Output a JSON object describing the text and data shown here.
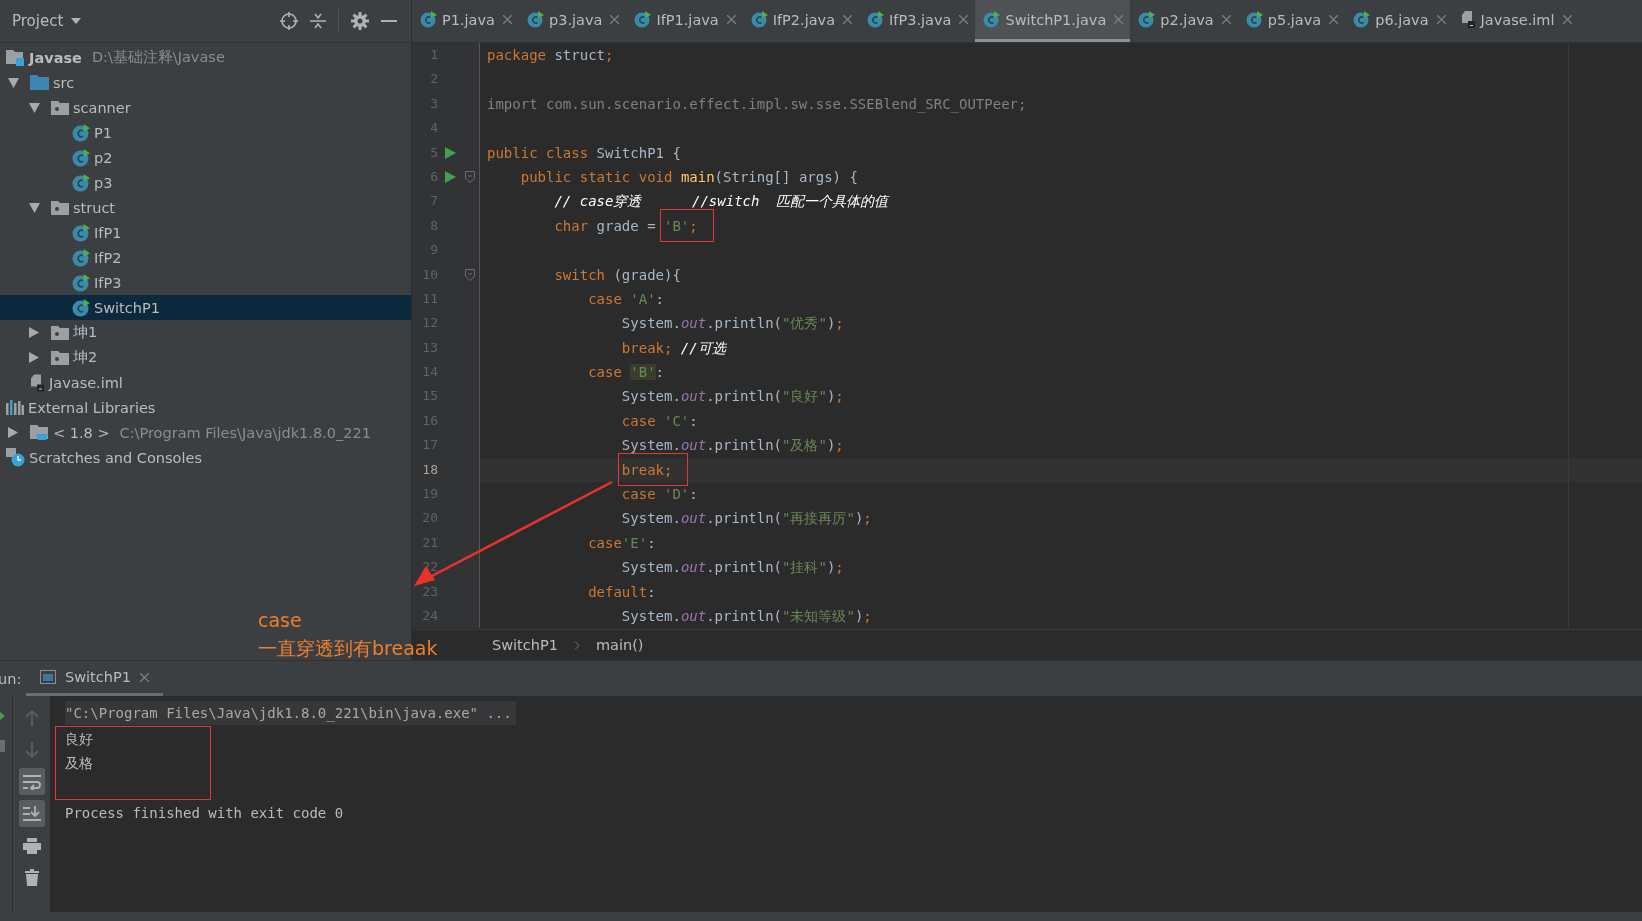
{
  "project_panel": {
    "title": "Project"
  },
  "tabs": [
    {
      "label": "P1.java",
      "kind": "class",
      "selected": false
    },
    {
      "label": "p3.java",
      "kind": "class",
      "selected": false
    },
    {
      "label": "IfP1.java",
      "kind": "class",
      "selected": false
    },
    {
      "label": "IfP2.java",
      "kind": "class",
      "selected": false
    },
    {
      "label": "IfP3.java",
      "kind": "class",
      "selected": false
    },
    {
      "label": "SwitchP1.java",
      "kind": "class",
      "selected": true
    },
    {
      "label": "p2.java",
      "kind": "class",
      "selected": false
    },
    {
      "label": "p5.java",
      "kind": "class",
      "selected": false
    },
    {
      "label": "p6.java",
      "kind": "class",
      "selected": false
    },
    {
      "label": "Javase.iml",
      "kind": "file",
      "selected": false
    }
  ],
  "tree": [
    {
      "label": "Javase",
      "hint": "D:\\基础注释\\Javase",
      "kind": "module",
      "bold": true,
      "selected": false
    },
    {
      "label": "src",
      "kind": "source",
      "expanded": true,
      "selected": false,
      "children": [
        {
          "label": "scanner",
          "kind": "package",
          "expanded": true,
          "selected": false,
          "children": [
            {
              "label": "P1",
              "kind": "class",
              "selected": false
            },
            {
              "label": "p2",
              "kind": "class",
              "selected": false
            },
            {
              "label": "p3",
              "kind": "class",
              "selected": false
            }
          ]
        },
        {
          "label": "struct",
          "kind": "package",
          "expanded": true,
          "selected": false,
          "children": [
            {
              "label": "IfP1",
              "kind": "class",
              "selected": false
            },
            {
              "label": "IfP2",
              "kind": "class",
              "selected": false
            },
            {
              "label": "IfP3",
              "kind": "class",
              "selected": false
            },
            {
              "label": "SwitchP1",
              "kind": "class",
              "selected": true
            }
          ]
        },
        {
          "label": "坤1",
          "kind": "package",
          "expanded": false,
          "selected": false
        },
        {
          "label": "坤2",
          "kind": "package",
          "expanded": false,
          "selected": false
        }
      ]
    },
    {
      "label": "Javase.iml",
      "kind": "file",
      "selected": false
    },
    {
      "label": "External Libraries",
      "kind": "libraries",
      "selected": false
    },
    {
      "label": "< 1.8 >",
      "hint": "C:\\Program Files\\Java\\jdk1.8.0_221",
      "kind": "jdk",
      "expanded": false,
      "selected": false
    },
    {
      "label": "Scratches and Consoles",
      "kind": "scratches",
      "selected": false
    }
  ],
  "code": [
    {
      "number": "1",
      "current": false,
      "tokens": [
        {
          "text": "package",
          "kind": "keyword"
        },
        {
          "text": " struct",
          "kind": "plain"
        },
        {
          "text": ";",
          "kind": "keyword"
        }
      ]
    },
    {
      "number": "2",
      "current": false
    },
    {
      "number": "3",
      "current": false,
      "tokens": [
        {
          "text": "import com.sun.scenario.effect.impl.sw.sse.SSEBlend_SRC_OUTPeer;",
          "kind": "unused"
        }
      ]
    },
    {
      "number": "4",
      "current": false
    },
    {
      "number": "5",
      "current": false,
      "run": true,
      "tokens": [
        {
          "text": "public class ",
          "kind": "keyword"
        },
        {
          "text": "SwitchP1 {",
          "kind": "plain"
        }
      ]
    },
    {
      "number": "6",
      "current": false,
      "run": true,
      "fold": true,
      "tokens": [
        {
          "text": "    public static void ",
          "kind": "keyword"
        },
        {
          "text": "main",
          "kind": "method"
        },
        {
          "text": "(String[] args) {",
          "kind": "plain"
        }
      ]
    },
    {
      "number": "7",
      "current": false,
      "tokens": [
        {
          "text": "        // case穿透      //switch  匹配一个具体的值",
          "kind": "comment"
        }
      ]
    },
    {
      "number": "8",
      "current": false,
      "tokens": [
        {
          "text": "        char",
          "kind": "keyword"
        },
        {
          "text": " grade = ",
          "kind": "plain"
        },
        {
          "text": "'B'",
          "kind": "string",
          "boxed": true
        },
        {
          "text": ";",
          "kind": "keyword",
          "boxed": true
        }
      ]
    },
    {
      "number": "9",
      "current": false
    },
    {
      "number": "10",
      "current": false,
      "fold": true,
      "tokens": [
        {
          "text": "        switch",
          "kind": "keyword"
        },
        {
          "text": " (grade){",
          "kind": "plain"
        }
      ]
    },
    {
      "number": "11",
      "current": false,
      "tokens": [
        {
          "text": "            case ",
          "kind": "keyword"
        },
        {
          "text": "'A'",
          "kind": "string"
        },
        {
          "text": ":",
          "kind": "plain"
        }
      ]
    },
    {
      "number": "12",
      "current": false,
      "tokens": [
        {
          "text": "                System.",
          "kind": "plain"
        },
        {
          "text": "out",
          "kind": "field"
        },
        {
          "text": ".println(",
          "kind": "plain"
        },
        {
          "text": "\"优秀\"",
          "kind": "string"
        },
        {
          "text": ")",
          "kind": "plain"
        },
        {
          "text": ";",
          "kind": "keyword"
        }
      ]
    },
    {
      "number": "13",
      "current": false,
      "tokens": [
        {
          "text": "                break;",
          "kind": "keyword"
        },
        {
          "text": " //可选",
          "kind": "comment"
        }
      ]
    },
    {
      "number": "14",
      "current": false,
      "tokens": [
        {
          "text": "            case ",
          "kind": "keyword"
        },
        {
          "text": "'B'",
          "kind": "match"
        },
        {
          "text": ":",
          "kind": "plain"
        }
      ]
    },
    {
      "number": "15",
      "current": false,
      "tokens": [
        {
          "text": "                System.",
          "kind": "plain"
        },
        {
          "text": "out",
          "kind": "field"
        },
        {
          "text": ".println(",
          "kind": "plain"
        },
        {
          "text": "\"良好\"",
          "kind": "string"
        },
        {
          "text": ")",
          "kind": "plain"
        },
        {
          "text": ";",
          "kind": "keyword"
        }
      ]
    },
    {
      "number": "16",
      "current": false,
      "tokens": [
        {
          "text": "                case ",
          "kind": "keyword"
        },
        {
          "text": "'C'",
          "kind": "string"
        },
        {
          "text": ":",
          "kind": "plain"
        }
      ]
    },
    {
      "number": "17",
      "current": false,
      "tokens": [
        {
          "text": "                System.",
          "kind": "plain"
        },
        {
          "text": "out",
          "kind": "field"
        },
        {
          "text": ".println(",
          "kind": "plain"
        },
        {
          "text": "\"及格\"",
          "kind": "string"
        },
        {
          "text": ")",
          "kind": "plain"
        },
        {
          "text": ";",
          "kind": "keyword"
        }
      ]
    },
    {
      "number": "18",
      "current": true,
      "tokens": [
        {
          "text": "                break;",
          "kind": "keyword",
          "boxed": true
        }
      ]
    },
    {
      "number": "19",
      "current": false,
      "tokens": [
        {
          "text": "                case ",
          "kind": "keyword"
        },
        {
          "text": "'D'",
          "kind": "string"
        },
        {
          "text": ":",
          "kind": "plain"
        }
      ]
    },
    {
      "number": "20",
      "current": false,
      "tokens": [
        {
          "text": "                System.",
          "kind": "plain"
        },
        {
          "text": "out",
          "kind": "field"
        },
        {
          "text": ".println(",
          "kind": "plain"
        },
        {
          "text": "\"再接再厉\"",
          "kind": "string"
        },
        {
          "text": ")",
          "kind": "plain"
        },
        {
          "text": ";",
          "kind": "keyword"
        }
      ]
    },
    {
      "number": "21",
      "current": false,
      "tokens": [
        {
          "text": "            case",
          "kind": "keyword"
        },
        {
          "text": "'E'",
          "kind": "string"
        },
        {
          "text": ":",
          "kind": "plain"
        }
      ]
    },
    {
      "number": "22",
      "current": false,
      "tokens": [
        {
          "text": "                System.",
          "kind": "plain"
        },
        {
          "text": "out",
          "kind": "field"
        },
        {
          "text": ".println(",
          "kind": "plain"
        },
        {
          "text": "\"挂科\"",
          "kind": "string"
        },
        {
          "text": ")",
          "kind": "plain"
        },
        {
          "text": ";",
          "kind": "keyword"
        }
      ]
    },
    {
      "number": "23",
      "current": false,
      "tokens": [
        {
          "text": "            default",
          "kind": "keyword"
        },
        {
          "text": ":",
          "kind": "plain"
        }
      ]
    },
    {
      "number": "24",
      "current": false,
      "tokens": [
        {
          "text": "                System.",
          "kind": "plain"
        },
        {
          "text": "out",
          "kind": "field"
        },
        {
          "text": ".println(",
          "kind": "plain"
        },
        {
          "text": "\"未知等级\"",
          "kind": "string"
        },
        {
          "text": ")",
          "kind": "plain"
        },
        {
          "text": ";",
          "kind": "keyword"
        }
      ]
    }
  ],
  "breadcrumbs": [
    "SwitchP1",
    "main()"
  ],
  "note": {
    "lines": [
      "case",
      "一直穿透到有breaak"
    ]
  },
  "run_panel": {
    "label": "un:",
    "tab": "SwitchP1",
    "toolbar": [
      {
        "kind": "up",
        "on": false,
        "disabled": true
      },
      {
        "kind": "down",
        "on": false,
        "disabled": true
      },
      {
        "kind": "wrap",
        "on": true,
        "disabled": false
      },
      {
        "kind": "scroll-end",
        "on": true,
        "disabled": false
      },
      {
        "kind": "print",
        "on": false,
        "disabled": false
      },
      {
        "kind": "trash",
        "on": false,
        "disabled": false
      }
    ],
    "console": [
      {
        "kind": "command",
        "boxed": false,
        "lines": [
          "\"C:\\Program Files\\Java\\jdk1.8.0_221\\bin\\java.exe\" ..."
        ]
      },
      {
        "kind": "output",
        "boxed": true,
        "lines": [
          "良好",
          "及格"
        ]
      },
      {
        "kind": "exit",
        "boxed": false,
        "lines": [
          "Process finished with exit code 0"
        ]
      }
    ]
  }
}
